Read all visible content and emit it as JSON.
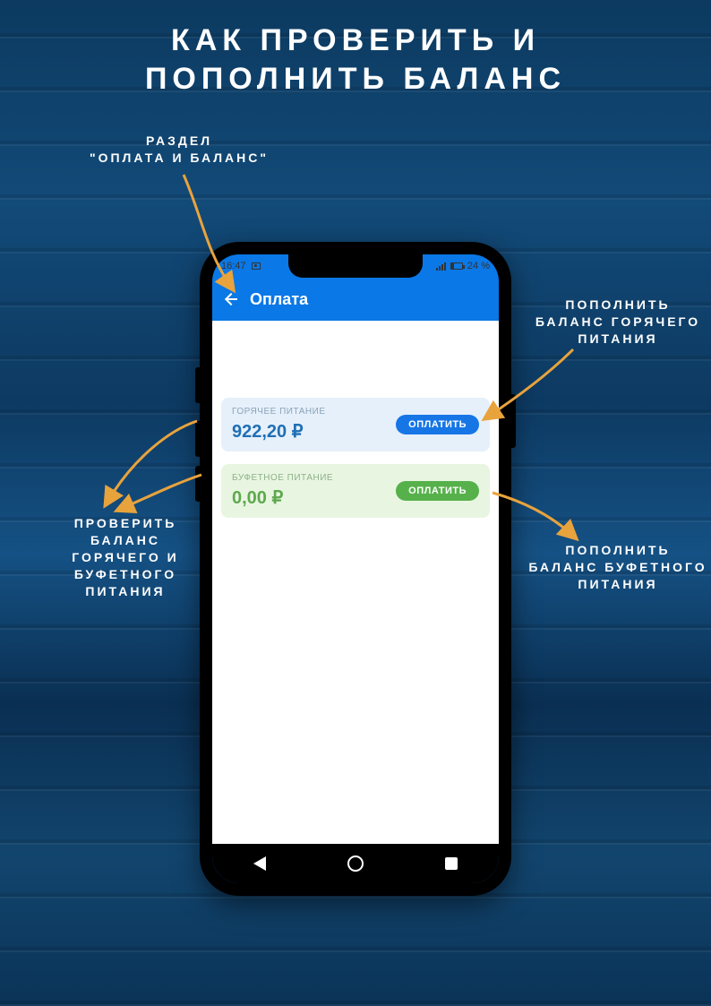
{
  "title_line1": "КАК ПРОВЕРИТЬ И",
  "title_line2": "ПОПОЛНИТЬ БАЛАНС",
  "annotations": {
    "section": "РАЗДЕЛ\n\"ОПЛАТА И БАЛАНС\"",
    "topup_hot": "ПОПОЛНИТЬ\nБАЛАНС ГОРЯЧЕГО\nПИТАНИЯ",
    "check_balances": "ПРОВЕРИТЬ\nБАЛАНС\nГОРЯЧЕГО И\nБУФЕТНОГО\nПИТАНИЯ",
    "topup_buffet": "ПОПОЛНИТЬ\nБАЛАНС БУФЕТНОГО\nПИТАНИЯ"
  },
  "phone": {
    "status": {
      "time": "16:47",
      "battery": "24 %"
    },
    "appbar_title": "Оплата",
    "cards": [
      {
        "label": "ГОРЯЧЕЕ ПИТАНИЕ",
        "amount": "922,20 ₽",
        "button": "ОПЛАТИТЬ",
        "variant": "blue"
      },
      {
        "label": "БУФЕТНОЕ ПИТАНИЕ",
        "amount": "0,00 ₽",
        "button": "ОПЛАТИТЬ",
        "variant": "green"
      }
    ]
  }
}
